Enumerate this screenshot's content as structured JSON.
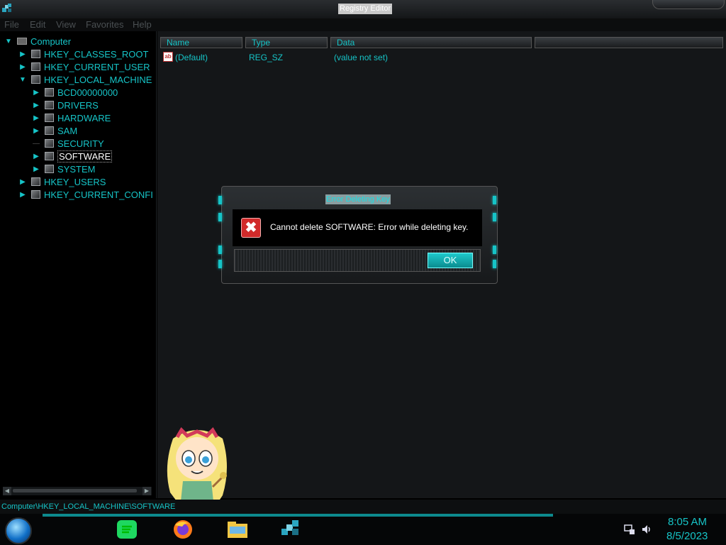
{
  "window": {
    "title": "Registry Editor"
  },
  "menu": [
    "File",
    "Edit",
    "View",
    "Favorites",
    "Help"
  ],
  "tree": {
    "root": "Computer",
    "hives": [
      "HKEY_CLASSES_ROOT",
      "HKEY_CURRENT_USER",
      "HKEY_LOCAL_MACHINE",
      "HKEY_USERS",
      "HKEY_CURRENT_CONFI"
    ],
    "hklm_children": [
      "BCD00000000",
      "DRIVERS",
      "HARDWARE",
      "SAM",
      "SECURITY",
      "SOFTWARE",
      "SYSTEM"
    ],
    "selected": "SOFTWARE"
  },
  "list": {
    "columns": [
      "Name",
      "Type",
      "Data"
    ],
    "rows": [
      {
        "name": "(Default)",
        "type": "REG_SZ",
        "data": "(value not set)"
      }
    ]
  },
  "status": {
    "path": "Computer\\HKEY_LOCAL_MACHINE\\SOFTWARE"
  },
  "dialog": {
    "title": "Error Deleting Key",
    "message": "Cannot delete SOFTWARE:  Error while deleting key.",
    "ok_label": "OK"
  },
  "clock": {
    "time": "8:05 AM",
    "date": "8/5/2023"
  },
  "colors": {
    "accent": "#16c4c7",
    "error": "#d12a2a",
    "background": "#000000"
  },
  "icons": [
    "regedit-icon",
    "folder-icon",
    "string-value-icon",
    "error-icon",
    "start-orb-icon",
    "spotify-icon",
    "firefox-icon",
    "file-explorer-icon",
    "network-icon",
    "volume-icon"
  ]
}
